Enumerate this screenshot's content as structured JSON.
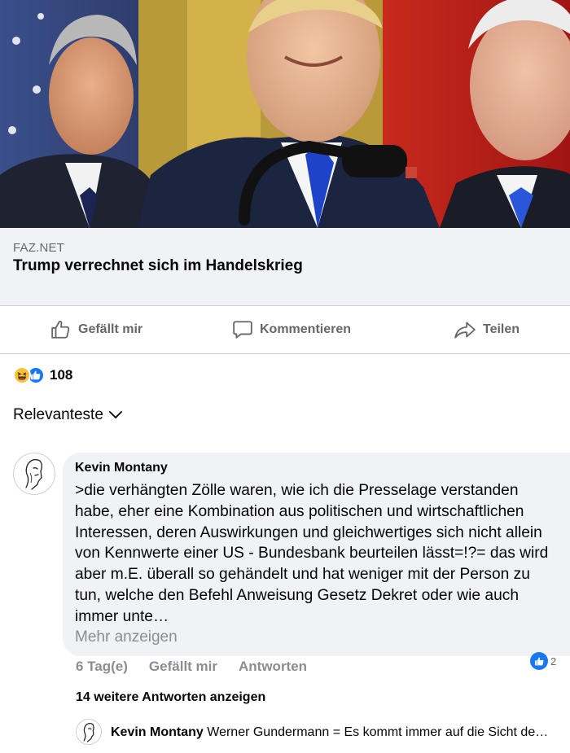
{
  "post_image": {
    "description_icon": "news-photo"
  },
  "link_preview": {
    "source": "FAZ.NET",
    "title": "Trump verrechnet sich im Handelskrieg"
  },
  "actions": {
    "like": "Gefällt mir",
    "comment": "Kommentieren",
    "share": "Teilen"
  },
  "reactions": {
    "count": "108",
    "types": [
      "haha-icon",
      "like-icon"
    ]
  },
  "sort": {
    "label": "Relevanteste"
  },
  "comment": {
    "author": "Kevin Montany",
    "text": ">die verhängten Zölle waren, wie ich die Presselage verstanden habe, eher eine Kombination aus politischen und wirtschaftlichen Interessen, deren Auswirkungen und gleichwertiges sich nicht  allein von Kennwerte einer US - Bundesbank  beurteilen lässt=!?= das wird aber m.E. überall so gehändelt und hat weniger mit der Person zu tun, welche den Befehl Anweisung Gesetz Dekret oder wie auch immer unte…",
    "see_more": "Mehr anzeigen",
    "time": "6 Tag(e)",
    "like_action": "Gefällt mir",
    "reply_action": "Antworten",
    "like_count": "2"
  },
  "more_replies": "14 weitere Antworten anzeigen",
  "reply_preview": {
    "author": "Kevin Montany",
    "text": "Werner Gundermann = Es kommt immer auf die Sicht de…"
  },
  "colors": {
    "like_blue": "#1877f2",
    "haha_yellow": "#f7c23a",
    "secondary_text": "#65676b",
    "bubble_bg": "#f0f2f5"
  }
}
